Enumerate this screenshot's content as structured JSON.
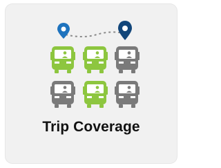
{
  "tile": {
    "label": "Trip Coverage",
    "icon": "trip-coverage-icon"
  },
  "colors": {
    "tile_background": "#f1f1f1",
    "route_pin": "#1e73be",
    "route_pin_dark": "#12467a",
    "bus_covered": "#8dc63f",
    "bus_uncovered": "#7a7a7a",
    "label": "#111111"
  },
  "buses": [
    {
      "status": "covered"
    },
    {
      "status": "covered"
    },
    {
      "status": "uncovered"
    },
    {
      "status": "uncovered"
    },
    {
      "status": "covered"
    },
    {
      "status": "uncovered"
    }
  ]
}
